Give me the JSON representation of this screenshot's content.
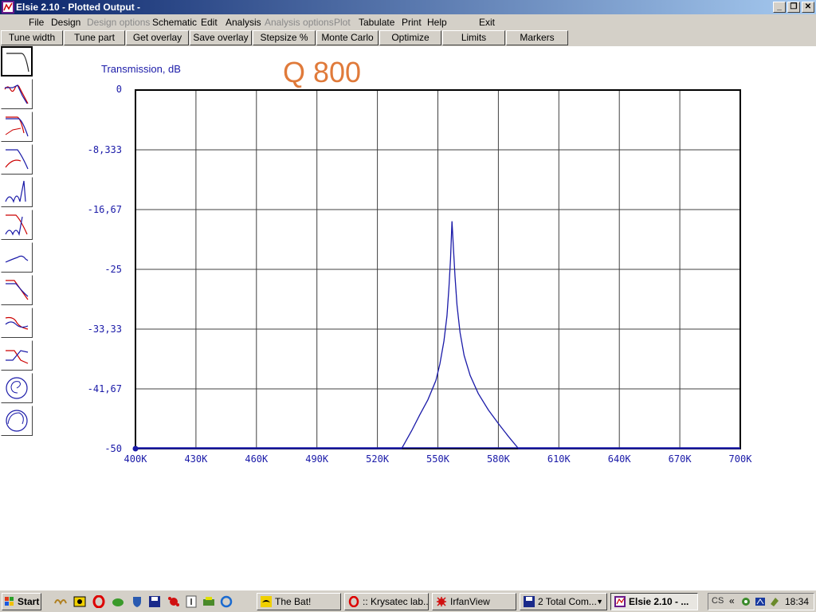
{
  "window": {
    "title": "Elsie 2.10 - Plotted Output -",
    "controls": [
      "_",
      "❐",
      "✕"
    ]
  },
  "menu": [
    {
      "label": "File",
      "disabled": false
    },
    {
      "label": "Design",
      "disabled": false
    },
    {
      "label": "Design options",
      "disabled": true
    },
    {
      "label": "Schematic",
      "disabled": false
    },
    {
      "label": "Edit",
      "disabled": false
    },
    {
      "label": "Analysis",
      "disabled": false
    },
    {
      "label": "Analysis options",
      "disabled": true
    },
    {
      "label": "Plot",
      "disabled": true
    },
    {
      "label": "Tabulate",
      "disabled": false
    },
    {
      "label": "Print",
      "disabled": false
    },
    {
      "label": "Help",
      "disabled": false
    },
    {
      "label": "Exit",
      "disabled": false
    }
  ],
  "toolbar": [
    "Tune width",
    "Tune part",
    "Get overlay",
    "Save overlay",
    "Stepsize %",
    "Monte Carlo",
    "Optimize",
    "Limits",
    "Markers"
  ],
  "plot_types": [
    "lowpass-response-icon",
    "ripple-response-icon",
    "lowpass-overlay-icon",
    "attenuation-overlay-icon",
    "bandpass-notch-icon",
    "notch-overlay-icon",
    "group-delay-icon",
    "step-response-icon",
    "phase-response-icon",
    "crossover-icon",
    "smith-chart-icon",
    "polar-chart-icon"
  ],
  "chart_data": {
    "type": "line",
    "title": "Q 800",
    "ylabel": "Transmission, dB",
    "xlabel": "",
    "xlim": [
      400000,
      700000
    ],
    "ylim": [
      -50,
      0
    ],
    "x_ticks": [
      "400K",
      "430K",
      "460K",
      "490K",
      "520K",
      "550K",
      "580K",
      "610K",
      "640K",
      "670K",
      "700K"
    ],
    "y_ticks": [
      "0",
      "-8,333",
      "-16,67",
      "-25",
      "-33,33",
      "-41,67",
      "-50"
    ],
    "grid": true,
    "series": [
      {
        "color": "#1a1aa8",
        "x": [
          400000,
          532000,
          537000,
          541000,
          545000,
          549000,
          551000,
          553000,
          554500,
          555500,
          556300,
          557000,
          557700,
          558500,
          559500,
          561000,
          563000,
          566000,
          570000,
          575000,
          580000,
          585000,
          590000,
          595000,
          700000
        ],
        "y": [
          -50,
          -50,
          -47.5,
          -45.3,
          -43.2,
          -40.5,
          -38.2,
          -35,
          -31.5,
          -27.5,
          -23.5,
          -18.3,
          -22,
          -26,
          -30,
          -33.8,
          -37,
          -39.8,
          -42.3,
          -44.6,
          -46.5,
          -48.3,
          -50,
          -50,
          -50
        ]
      }
    ]
  },
  "taskbar": {
    "start_label": "Start",
    "quicklaunch": [
      "winamp-icon",
      "media-icon",
      "opera-icon",
      "frog-icon",
      "shield-icon",
      "floppy-icon",
      "splat-icon",
      "info-icon",
      "printer-icon",
      "ie-icon"
    ],
    "tasks": [
      {
        "label": "The Bat!",
        "active": false,
        "icon": "bat-icon"
      },
      {
        "label": ":: Krysatec lab...",
        "active": false,
        "icon": "opera-icon"
      },
      {
        "label": "IrfanView",
        "active": false,
        "icon": "irfanview-icon"
      },
      {
        "label": "2 Total Com...",
        "active": false,
        "icon": "floppy-icon"
      },
      {
        "label": "Elsie 2.10 - ...",
        "active": true,
        "icon": "elsie-icon"
      }
    ],
    "tray_label": "CS",
    "clock": "18:34"
  }
}
